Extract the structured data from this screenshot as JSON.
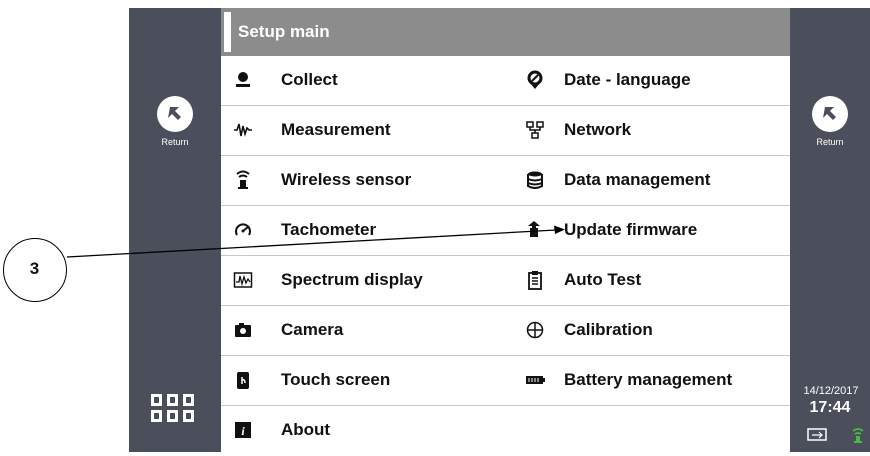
{
  "header": {
    "title": "Setup main"
  },
  "sidebar_left": {
    "return_label": "Return",
    "return_icon": "return-arrow-icon",
    "menu_icon": "apps-grid-icon"
  },
  "sidebar_right": {
    "return_label": "Return",
    "return_icon": "return-arrow-icon"
  },
  "menu": {
    "rows": [
      {
        "left": {
          "label": "Collect",
          "icon": "collect-icon"
        },
        "right": {
          "label": "Date - language",
          "icon": "location-pin-icon"
        }
      },
      {
        "left": {
          "label": "Measurement",
          "icon": "waveform-icon"
        },
        "right": {
          "label": "Network",
          "icon": "network-icon"
        }
      },
      {
        "left": {
          "label": "Wireless sensor",
          "icon": "wireless-sensor-icon"
        },
        "right": {
          "label": "Data management",
          "icon": "database-icon"
        }
      },
      {
        "left": {
          "label": "Tachometer",
          "icon": "tachometer-icon"
        },
        "right": {
          "label": "Update firmware",
          "icon": "update-firmware-icon"
        }
      },
      {
        "left": {
          "label": "Spectrum display",
          "icon": "spectrum-icon"
        },
        "right": {
          "label": "Auto Test",
          "icon": "clipboard-icon"
        }
      },
      {
        "left": {
          "label": "Camera",
          "icon": "camera-icon"
        },
        "right": {
          "label": "Calibration",
          "icon": "crosshair-icon"
        }
      },
      {
        "left": {
          "label": "Touch screen",
          "icon": "touch-hand-icon"
        },
        "right": {
          "label": "Battery management",
          "icon": "battery-icon"
        }
      },
      {
        "left": {
          "label": "About",
          "icon": "info-icon"
        }
      }
    ]
  },
  "status": {
    "date": "14/12/2017",
    "time": "17:44",
    "icons": [
      "usb-icon",
      "wireless-status-icon"
    ]
  },
  "callout": {
    "label": "3"
  },
  "colors": {
    "sidebar": "#4b4f5c",
    "title_bar": "#8c8c8c",
    "wireless_status": "#49b749"
  }
}
